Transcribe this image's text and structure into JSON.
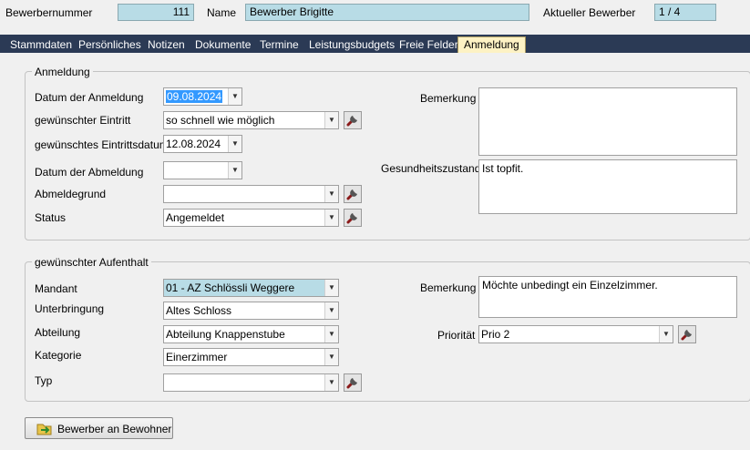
{
  "header": {
    "applicant_number_label": "Bewerbernummer",
    "applicant_number_value": "111",
    "name_label": "Name",
    "name_value": "Bewerber Brigitte",
    "current_label": "Aktueller Bewerber",
    "current_value": "1 / 4"
  },
  "tabs": [
    {
      "label": "Stammdaten"
    },
    {
      "label": "Persönliches"
    },
    {
      "label": "Notizen"
    },
    {
      "label": "Dokumente"
    },
    {
      "label": "Termine"
    },
    {
      "label": "Leistungsbudgets"
    },
    {
      "label": "Freie Felder"
    },
    {
      "label": "Anmeldung"
    }
  ],
  "anmeldung": {
    "group_title": "Anmeldung",
    "datum_anmeldung": {
      "label": "Datum der Anmeldung",
      "value": "09.08.2024"
    },
    "eintritt": {
      "label": "gewünschter Eintritt",
      "value": "so schnell wie möglich"
    },
    "eintrittsdatum": {
      "label": "gewünschtes Eintrittsdatum",
      "value": "12.08.2024"
    },
    "datum_abmeldung": {
      "label": "Datum der Abmeldung",
      "value": ""
    },
    "abmeldegrund": {
      "label": "Abmeldegrund",
      "value": ""
    },
    "status": {
      "label": "Status",
      "value": "Angemeldet"
    },
    "bemerkung": {
      "label": "Bemerkung",
      "value": ""
    },
    "gesundheit": {
      "label": "Gesundheitszustand",
      "value": "Ist topfit."
    }
  },
  "aufenthalt": {
    "group_title": "gewünschter Aufenthalt",
    "mandant": {
      "label": "Mandant",
      "value": "01 - AZ Schlössli Weggere"
    },
    "unterbringung": {
      "label": "Unterbringung",
      "value": "Altes Schloss"
    },
    "abteilung": {
      "label": "Abteilung",
      "value": "Abteilung Knappenstube"
    },
    "kategorie": {
      "label": "Kategorie",
      "value": "Einerzimmer"
    },
    "typ": {
      "label": "Typ",
      "value": ""
    },
    "bemerkung": {
      "label": "Bemerkung",
      "value": "Möchte unbedingt ein Einzelzimmer."
    },
    "prioritaet": {
      "label": "Priorität",
      "value": "Prio 2"
    }
  },
  "buttons": {
    "transfer": "Bewerber an Bewohner"
  },
  "colors": {
    "tab_bar": "#2b3a55",
    "active_tab": "#fdf2c4",
    "header_field": "#b8dce6",
    "selection": "#3399ff"
  },
  "icons": {
    "tool": "wrench-icon",
    "dropdown": "chevron-down-icon",
    "transfer": "folder-arrow-icon"
  }
}
